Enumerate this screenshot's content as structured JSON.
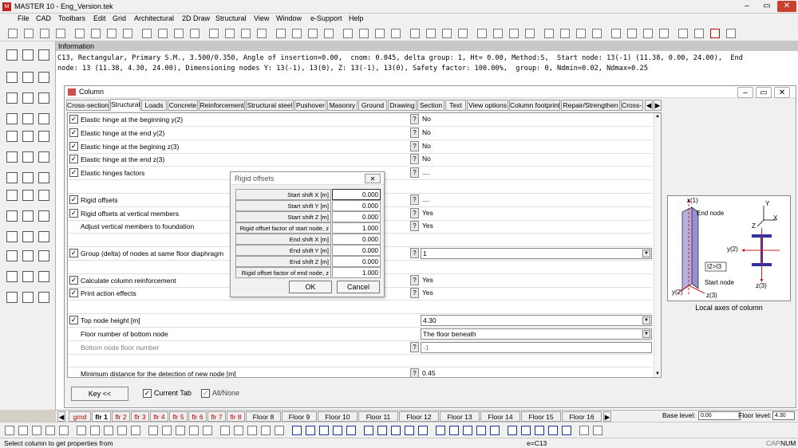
{
  "app": {
    "title": "MASTER 10 - Eng_Version.tek",
    "icon": "master-app-icon"
  },
  "menu": [
    "File",
    "CAD",
    "Toolbars",
    "Edit",
    "Grid",
    "Architectural",
    "2D Draw",
    "Structural",
    "View",
    "Window",
    "e-Support",
    "Help"
  ],
  "info": {
    "header": "Information",
    "line1": "C13, Rectangular, Primary S.M., 3.500/0.350, Angle of insertion=0.00,  cnom: 0.045, delta group: 1, Ht= 0.00, Method:S,  Start node: 13(-1) (11.38, 0.00, 24.00),  End",
    "line2": "node: 13 (11.38, 4.30, 24.00), Dimensioning nodes Y: 13(-1), 13(0), Z: 13(-1), 13(0), Safety factor: 100.00%,  group: 0, Ndmin=0.02, Ndmax=0.25"
  },
  "column_window": {
    "title": "Column",
    "tabs": [
      "Cross-section",
      "Structural",
      "Loads",
      "Concrete",
      "Reinforcement",
      "Structural steel",
      "Pushover",
      "Masonry",
      "Ground",
      "Drawing",
      "Section",
      "Text",
      "View options",
      "Column footprint",
      "Repair/Strengthen",
      "Cross-S"
    ],
    "active_tab": "Structural",
    "rows": [
      {
        "checked": true,
        "label": "Elastic hinge at the beginning y(2)",
        "help": "?",
        "value": "No"
      },
      {
        "checked": true,
        "label": "Elastic hinge at the end y(2)",
        "help": "?",
        "value": "No"
      },
      {
        "checked": true,
        "label": "Elastic hinge at the begining z(3)",
        "help": "?",
        "value": "No"
      },
      {
        "checked": true,
        "label": "Elastic hinge at the end z(3)",
        "help": "?",
        "value": "No"
      },
      {
        "checked": true,
        "label": "Elastic hinges factors",
        "help": "?",
        "value": "...."
      },
      {
        "checked": false,
        "label": "",
        "help": "",
        "value": ""
      },
      {
        "checked": true,
        "label": "Rigid offsets",
        "help": "?",
        "value": "...."
      },
      {
        "checked": true,
        "label": "Rigid offsets at vertical members",
        "help": "?",
        "value": "Yes"
      },
      {
        "checked": false,
        "label": "Adjust vertical members to foundation",
        "help": "?",
        "value": "Yes"
      },
      {
        "checked": false,
        "label": "",
        "help": "",
        "value": ""
      },
      {
        "checked": true,
        "label": "Group (delta) of nodes at same floor diaphragm",
        "help": "?",
        "value": "1",
        "dropdown": true
      },
      {
        "checked": false,
        "label": "",
        "help": "",
        "value": ""
      },
      {
        "checked": true,
        "label": "Calculate column reinforcement",
        "help": "?",
        "value": "Yes"
      },
      {
        "checked": true,
        "label": "Print action effects",
        "help": "?",
        "value": "Yes"
      },
      {
        "checked": false,
        "label": "",
        "help": "",
        "value": ""
      },
      {
        "checked": true,
        "label": "Top node height [m]",
        "help": "",
        "value": "4.30",
        "dropdown": true
      },
      {
        "checked": false,
        "label": "Floor number of bottom node",
        "help": "",
        "value": "The floor beneath",
        "dropdown": true
      },
      {
        "checked": false,
        "label": "Bottom node floor number",
        "help": "?",
        "value": "-1",
        "disabled": true
      },
      {
        "checked": false,
        "label": "",
        "help": "",
        "value": ""
      },
      {
        "checked": false,
        "label": "Minimum distance for the detection of new node [m]",
        "help": "?",
        "value": "0.45"
      }
    ],
    "key_button": "Key <<",
    "current_tab_label": "Current Tab",
    "all_none_label": "All/None",
    "axes_caption": "Local axes of column",
    "axes_labels": {
      "x1": "x(1)",
      "end_node": "End node",
      "start_node": "Start node",
      "y2": "y(2)",
      "z3": "z(3)",
      "i2i3": "I2>I3",
      "y2b": "y(2)",
      "z3b": "z(3)",
      "Y": "Y",
      "X": "X",
      "Z": "Z"
    }
  },
  "rigid_offsets_dialog": {
    "title": "Rigid offsets",
    "rows": [
      {
        "label": "Start shift X [m]",
        "value": "0.000"
      },
      {
        "label": "Start shift Y [m]",
        "value": "0.000"
      },
      {
        "label": "Start shift Z [m]",
        "value": "0.000"
      },
      {
        "label": "Rigid offset factor of start node, z",
        "value": "1.000"
      },
      {
        "label": "End shift X [m]",
        "value": "0.000"
      },
      {
        "label": "End shift Y [m]",
        "value": "0.000"
      },
      {
        "label": "End shift Z [m]",
        "value": "0.000"
      },
      {
        "label": "Rigid offset factor of end node, z",
        "value": "1.000"
      }
    ],
    "ok": "OK",
    "cancel": "Cancel"
  },
  "floor_tabs": [
    "grnd",
    "flr 1",
    "flr 2",
    "flr 3",
    "flr 4",
    "flr 5",
    "flr 6",
    "flr 7",
    "flr 8",
    "Floor 8",
    "Floor 9",
    "Floor 10",
    "Floor 11",
    "Floor 12",
    "Floor 13",
    "Floor 14",
    "Floor 15",
    "Floor 16"
  ],
  "active_floor": "flr 1",
  "base_level_label": "Base level:",
  "base_level_value": "0.00",
  "floor_level_label": "Floor level:",
  "floor_level_value": "4.30",
  "status": {
    "left": "Select column to get properties from",
    "center": "e=C13",
    "caps": "CAP",
    "num": "NUM"
  }
}
